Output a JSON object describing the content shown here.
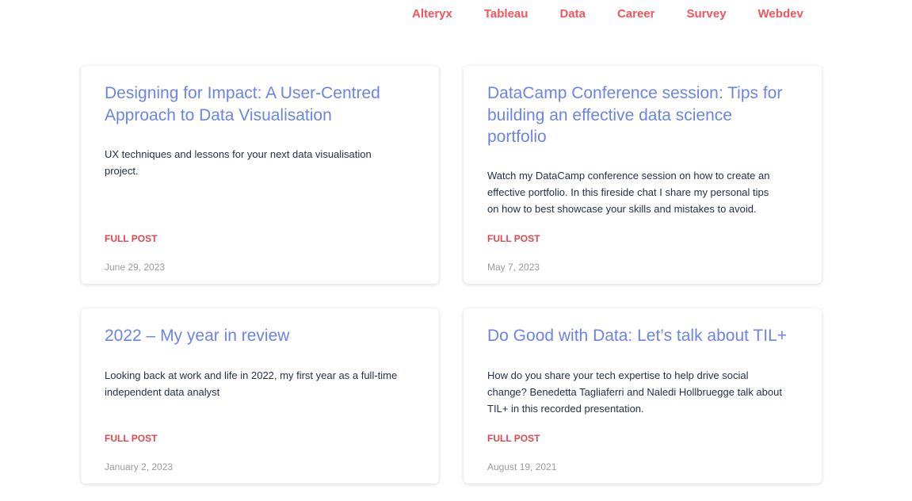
{
  "nav": {
    "items": [
      {
        "label": "Alteryx"
      },
      {
        "label": "Tableau"
      },
      {
        "label": "Data"
      },
      {
        "label": "Career"
      },
      {
        "label": "Survey"
      },
      {
        "label": "Webdev"
      }
    ]
  },
  "posts": [
    {
      "title": "Designing for Impact: A User-Centred Approach to Data Visualisation",
      "excerpt": "UX techniques and lessons for your next data visualisation project.",
      "link_label": "FULL POST",
      "date": "June 29, 2023"
    },
    {
      "title": "DataCamp Conference session: Tips for building an effective data science portfolio",
      "excerpt": "Watch my DataCamp conference session on how to create an effective portfolio. In this fireside chat I share my personal tips on how to best showcase your skills and mistakes to avoid.",
      "link_label": "FULL POST",
      "date": "May 7, 2023"
    },
    {
      "title": "2022 – My year in review",
      "excerpt": "Looking back at work and life in 2022, my first year as a full-time independent data analyst",
      "link_label": "FULL POST",
      "date": "January 2, 2023"
    },
    {
      "title": "Do Good with Data: Let’s talk about TIL+",
      "excerpt": "How do you share your tech expertise to help drive social change? Benedetta Tagliaferri and Naledi Hollbruegge talk about TIL+ in this recorded presentation.",
      "link_label": "FULL POST",
      "date": "August 19, 2021"
    }
  ]
}
